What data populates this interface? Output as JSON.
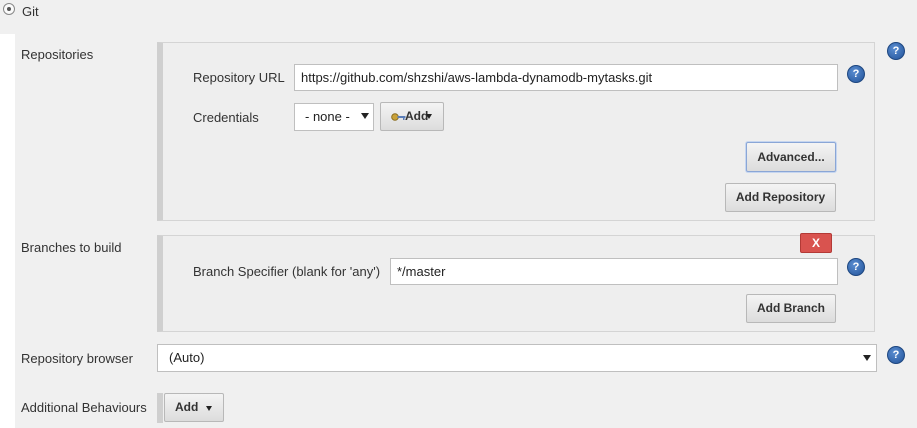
{
  "scm": {
    "option_label": "Git"
  },
  "repositories": {
    "label": "Repositories",
    "url_label": "Repository URL",
    "url_value": "https://github.com/shzshi/aws-lambda-dynamodb-mytasks.git",
    "credentials_label": "Credentials",
    "credentials_value": "- none -",
    "add_label": "Add",
    "advanced_label": "Advanced...",
    "add_repository_label": "Add Repository"
  },
  "branches": {
    "label": "Branches to build",
    "delete_label": "X",
    "specifier_label": "Branch Specifier (blank for 'any')",
    "specifier_value": "*/master",
    "add_branch_label": "Add Branch"
  },
  "browser": {
    "label": "Repository browser",
    "value": "(Auto)"
  },
  "behaviours": {
    "label": "Additional Behaviours",
    "add_label": "Add"
  },
  "icons": {
    "help": "help-icon",
    "key": "key-icon",
    "dropdown": "chevron-down-icon"
  },
  "colors": {
    "delete_button": "#d9534f",
    "help_icon": "#2f6cb5",
    "section_background": "#f0f0f0"
  }
}
